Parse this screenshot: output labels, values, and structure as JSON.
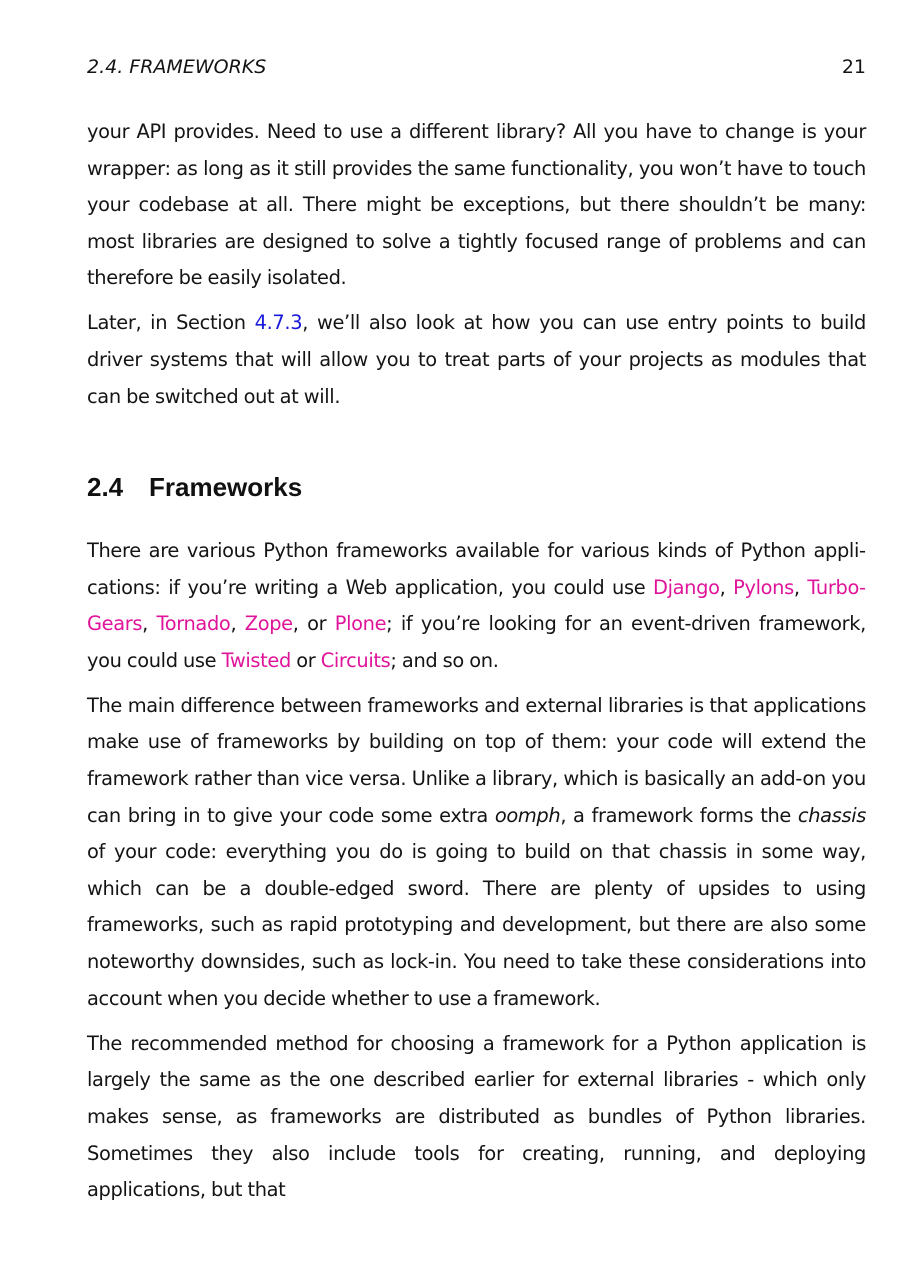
{
  "header": {
    "running_head": "2.4. FRAMEWORKS",
    "page_number": "21"
  },
  "block1": {
    "p1": "your API provides. Need to use a different library? All you have to change is your wrapper: as long as it still provides the same functionality, you won’t have to touch your codebase at all. There might be exceptions, but there shouldn’t be many: most libraries are designed to solve a tightly focused range of problems and can therefore be easily isolated.",
    "p2_a": "Later, in Section ",
    "p2_link": "4.7.3",
    "p2_b": ", we’ll also look at how you can use entry points to build driver systems that will allow you to treat parts of your projects as modules that can be switched out at will."
  },
  "section": {
    "number": "2.4",
    "title": "Frameworks"
  },
  "block2": {
    "p1_a": "There are various Python frameworks available for various kinds of Python appli­cations: if you’re writing a Web application, you could use ",
    "links": [
      "Django",
      "Pylons",
      "Turbo­Gears",
      "Tornado",
      "Zope",
      "Plone",
      "Twisted",
      "Circuits"
    ],
    "sep_comma": ", ",
    "sep_or": ", or ",
    "p1_mid": "; if you’re looking for an event-driven framework, you could use ",
    "p1_or": " or ",
    "p1_end": "; and so on.",
    "p2_a": "The main difference between frameworks and external libraries is that applications make use of frameworks by building on top of them: your code will extend the framework rather than vice versa. Unlike a library, which is basically an add-on you can bring in to give your code some extra ",
    "p2_em1": "oomph",
    "p2_b": ", a framework forms the ",
    "p2_em2": "chassis",
    "p2_c": " of your code: everything you do is going to build on that chassis in some way, which can be a double-edged sword. There are plenty of upsides to using frameworks, such as rapid prototyping and development, but there are also some noteworthy downsides, such as lock-in. You need to take these considerations into account when you decide whether to use a framework.",
    "p3": "The recommended method for choosing a framework for a Python application is largely the same as the one described earlier for external libraries - which only makes sense, as frameworks are distributed as bundles of Python libraries. Sometimes they also include tools for creating, running, and deploying applications, but that"
  }
}
